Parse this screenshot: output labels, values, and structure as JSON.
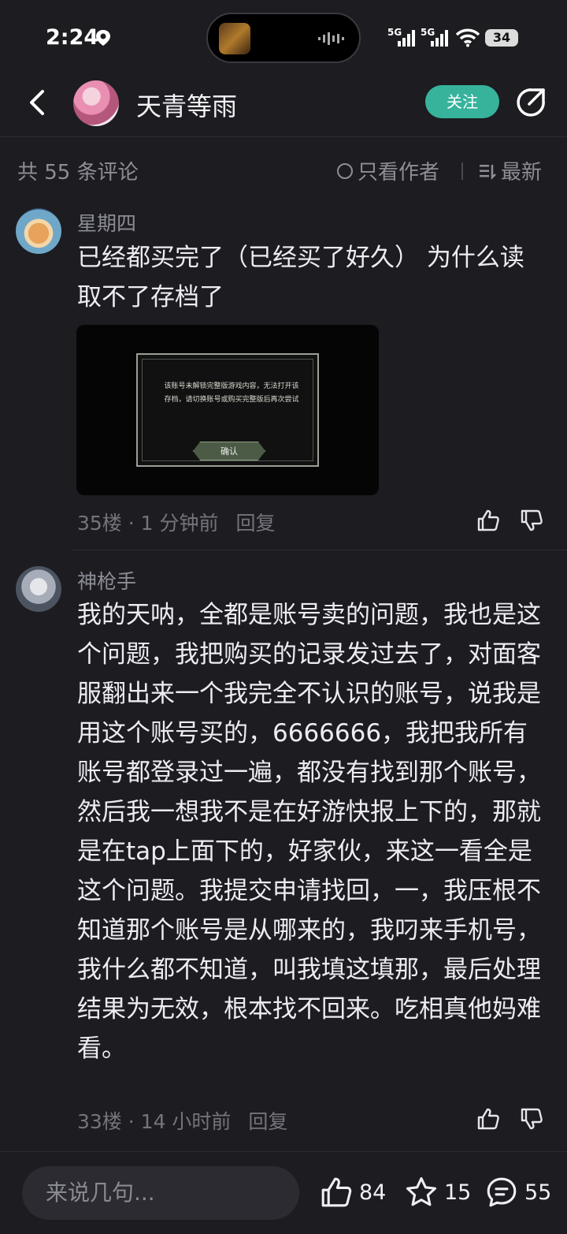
{
  "status_bar": {
    "time": "2:24",
    "signal1": "5G",
    "signal2": "5G",
    "battery": "34"
  },
  "header": {
    "title": "天青等雨",
    "follow_label": "关注"
  },
  "filter": {
    "count_text": "共 55 条评论",
    "author_only_label": "只看作者",
    "sort_label": "最新"
  },
  "comments": [
    {
      "name": "星期四",
      "body": "已经都买完了（已经买了好久） 为什么读取不了存档了",
      "floor": "35楼",
      "time": "1 分钟前",
      "reply": "回复",
      "image_dialog": {
        "text": "该账号未解锁完整版游戏内容，无法打开该存档，请切换账号或购买完整版后再次尝试",
        "button": "确认"
      }
    },
    {
      "name": "神枪手",
      "body": "我的天呐，全都是账号卖的问题，我也是这个问题，我把购买的记录发过去了，对面客服翻出来一个我完全不认识的账号，说我是用这个账号买的，6666666，我把我所有账号都登录过一遍，都没有找到那个账号，然后我一想我不是在好游快报上下的，那就是在tap上面下的，好家伙，来这一看全是这个问题。我提交申请找回，一，我压根不知道那个账号是从哪来的，我叼来手机号，我什么都不知道，叫我填这填那，最后处理结果为无效，根本找不回来。吃相真他妈难看。",
      "floor": "33楼",
      "time": "14 小时前",
      "reply": "回复"
    }
  ],
  "bottom_bar": {
    "input_placeholder": "来说几句...",
    "likes": "84",
    "favorites": "15",
    "comments": "55"
  },
  "colors": {
    "background": "#1c1c21",
    "accent": "#37b39c",
    "muted_text": "#8e8e96"
  }
}
